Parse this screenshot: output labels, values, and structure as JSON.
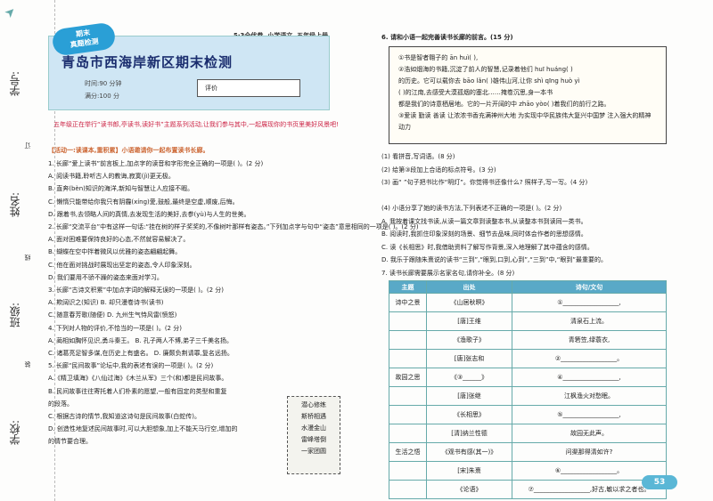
{
  "binding": {
    "school": "学校:",
    "class": "班级:",
    "name": "姓名:",
    "number": "学号:",
    "xian": "线",
    "ding": "订",
    "zhuang": "装"
  },
  "header": {
    "series": "5·3全优卷",
    "subject": "小学语文",
    "grade": "五年级上册"
  },
  "banner": {
    "badge_line1": "期末",
    "badge_line2": "真题检测",
    "title": "青岛市西海岸新区期末检测",
    "time": "时间:90 分钟",
    "full": "满分:100 分",
    "score_label": "评价"
  },
  "intro": "五年级正在举行“读书郎,亭读书,读好书”主题系列活动,让我们参与其中,一起展现你的书页里美好风景吧!",
  "section": "【活动一:读课本,重积累】小语邀请你一起布置读书长廊。",
  "left_questions": [
    "1. 长廊“爱上读书”前言板上,加点字的读音和字形完全正确的一项是(   )。(2 分)",
    "A. 阅读书籍,聆听古人的教诲,寂寞(jì)更无极。",
    "B. 直奔(bèn)知识的海洋,新知与智慧让人应接不暇。",
    "C. 懒惰只能带给你我只有阴霾(xíng)愛,鼓般,最终是空虚,顺废,后悔。",
    "D. 跟着书,去领略人间的真情,去发现生活的美好,去参(yù)与人生的世美。",
    "2. 长廊“交流平台”中有这样一句话:“挂在树的样子奖奖的,不像树叶那样有姿态。”下列加点字与句中“姿态”意思相同的一项是(   )。(2 分)",
    "A. 面对困难要保持良好的心态,不然就容易解决了。",
    "B. 蝴蝶在空中拌着微风以优雅的姿态翩翩起舞。",
    "C. 他在面对挑战时展现出坚定的姿态,令人印象深刻。",
    "D. 我们要用不骄不躁的姿态来面对学习。",
    "3. 长廊“古诗文积累”中加点字词的解释无误的一项是(   )。(2 分)",
    "A. 欺阔识之(知识)                B. 却只漫卷诗书(读书)",
    "C. 随意春芳歌(随便)              D. 九州生气恃风雷(愤怒)",
    "4. 下列对人物的评价,不恰当的一项是(   )。(2 分)",
    "A. 蔺相如胸怀见识,勇斗秦王。      B. 孔子两人不博,弟子三千美名扬。",
    "C. 诸葛亮足智多谋,在历史上有盛名。 D. 廉颇负荆请罪,复名远扬。",
    "5. 长廊“民间故事”论坛中,我的表述有误的一项是(   )。(2 分)",
    "A.《精卫填海》《八仙过海》《木兰从军》三个(和)都是民间故事。",
    "B. 民间故事往往寄托着人们朴素的愿望,一般有固定的类型和重复",
    "   的段落。",
    "C. 根据古诗的情节,我知道这诗句是民间故事(白蛇传)。",
    "D. 创造性地复述民间故事时,可以大胆想象,加上不能天马行空,增加的",
    "   的情节要合理。"
  ],
  "note": [
    "潜心修练",
    "斯桥相遇",
    "水漫金山",
    "雷峰塔倒",
    "一家团圆"
  ],
  "right_questions": {
    "q6": "6. 请和小语一起完善读书长廊的前言。(15 分)",
    "box": [
      "①书是智者翱子的 ān huì(      ),",
      "②浩如烟海的书籍,沉淀了前人的智慧,记录着他们 huī huáng(      )",
      "的历史。它可以载你去 bāo lǎn(      )雄伟山河,让你 shì qīng huò yì",
      "(      )的江南,去感受大漠孤烟的塞北……掩卷沉思,身一本书",
      "都是我们的诗意栖居地。它的一片开阔的中 zhāo yòo(      )着我们的前行之路。",
      "③爱读   勤读   善读   让浓浓书香充满神州大地   为实现中华民族伟大复兴中国梦   注入强大的精神动力"
    ],
    "sub": [
      "(1) 看拼音,写词语。(8 分)",
      "(2) 给第③段加上合适的标点符号。(3 分)",
      "(3) 画“    ”句子把书比作“明灯”。你觉得书还像什么? 照样子,写一写。(4 分)",
      "",
      "(4) 小语分享了她的读书方法,下列表述不正确的一项是(   )。(2 分)",
      "A. 我按着课文找书读,从读一篇文章到读整本书,从读整本书到读同一类书。",
      "B. 阅读时,我抓住印象深刻的场景、细节去品味,同时体会作者的思想感情。",
      "C. 读《长相思》时,我借助资料了解写作背景,深入地理解了其中蕴含的感情。",
      "D. 我乐于跟随朱熹说的读书“三到”,“眼到,口到,心到”,“三到”中,“眼到”最重要的。",
      "7. 读书长廊需要展示名家名句,请你补全。(8 分)"
    ]
  },
  "table": {
    "headers": [
      "主题",
      "出处",
      "诗句/文句"
    ],
    "rows": [
      [
        "诗中之景",
        "《山居秋暝》",
        "①__________________,"
      ],
      [
        "",
        "[唐]王维",
        "清泉石上流。"
      ],
      [
        "",
        "《渔歌子》",
        "青箬笠,绿蓑衣,"
      ],
      [
        "",
        "[唐]张志和",
        "②__________________。"
      ],
      [
        "故园之思",
        "《③______》",
        "④__________________,"
      ],
      [
        "",
        "[唐]张继",
        "江枫渔火对愁眠。"
      ],
      [
        "",
        "《长相思》",
        "⑤__________________,"
      ],
      [
        "",
        "[清]纳兰性德",
        "故园无此声。"
      ],
      [
        "生活之悟",
        "《观书有感(其一)》",
        "问渠那得清如许?"
      ],
      [
        "",
        "[宋]朱熹",
        "⑥__________________。"
      ],
      [
        "",
        "《论语》",
        "⑦__________________,好古,敏以求之者也。"
      ]
    ]
  },
  "page_number": "53"
}
